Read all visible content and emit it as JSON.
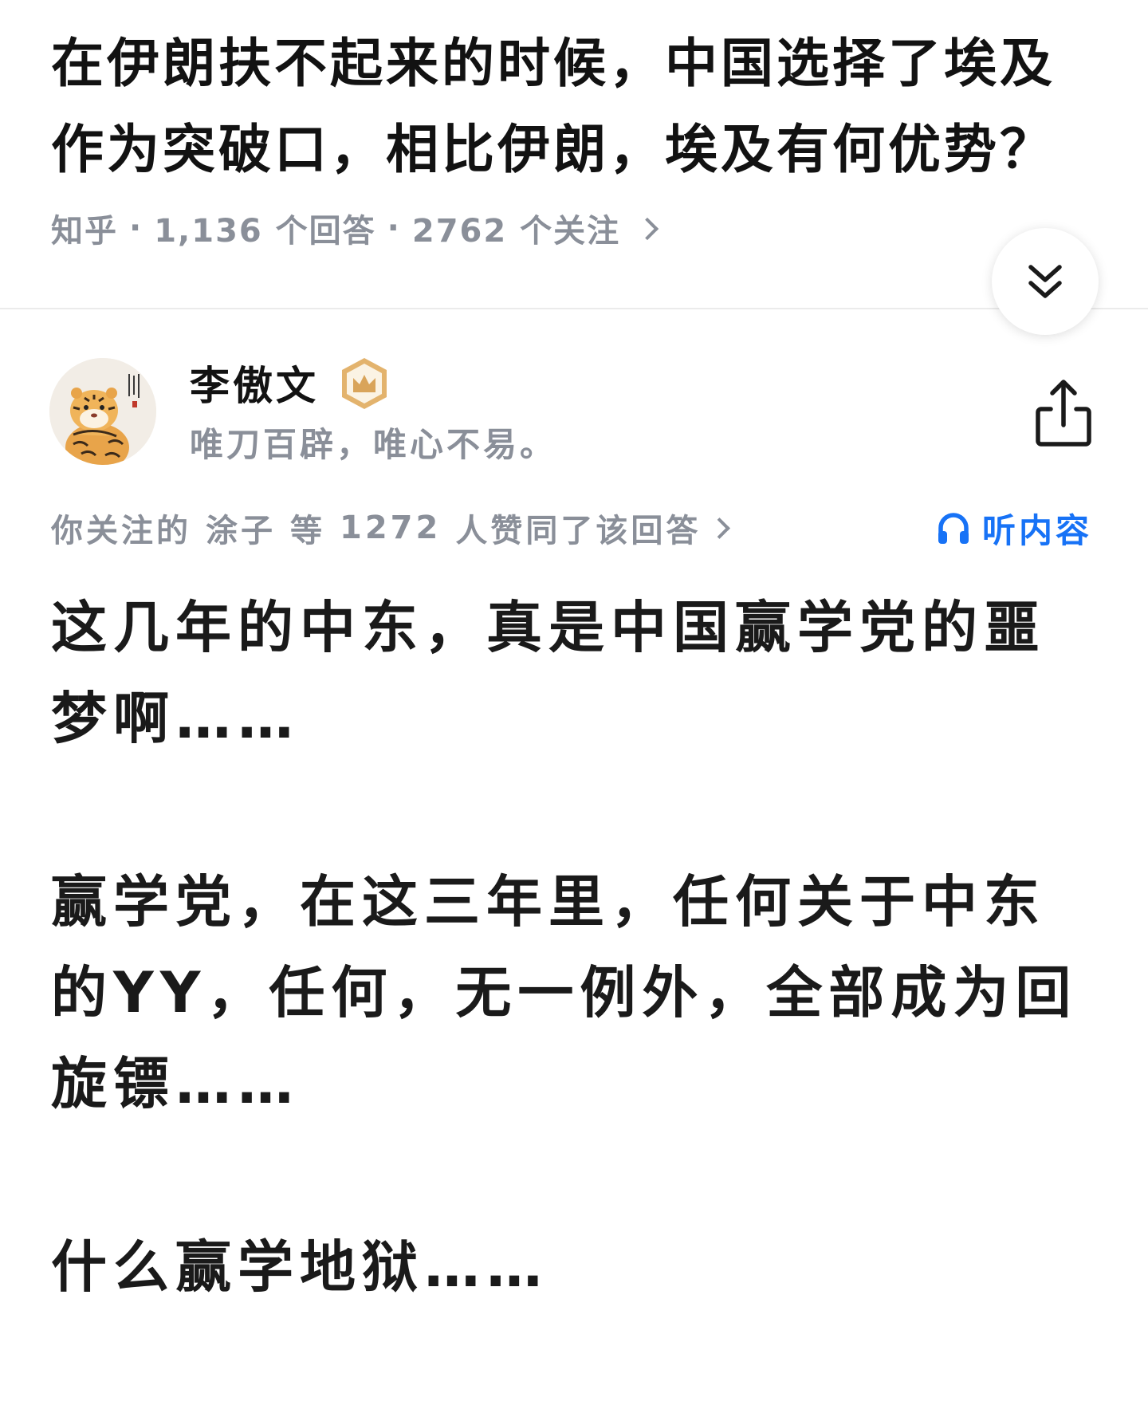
{
  "question": {
    "title": "在伊朗扶不起来的时候，中国选择了埃及作为突破口，相比伊朗，埃及有何优势？",
    "source": "知乎",
    "answers_count": "1,136 个回答",
    "followers_count": "2762 个关注"
  },
  "collapse": {
    "icon": "double-chevron-down-icon"
  },
  "author": {
    "name": "李傲文",
    "badge_icon": "crown-badge-icon",
    "bio": "唯刀百辟，唯心不易。"
  },
  "endorse": {
    "prefix": "你关注的",
    "friend": "涂子",
    "middle": "等",
    "count": "1272",
    "suffix": "人赞同了该回答"
  },
  "listen": {
    "label": "听内容",
    "icon": "headphones-icon"
  },
  "answer": {
    "paragraphs": [
      "这几年的中东，真是中国赢学党的噩梦啊……",
      "赢学党，在这三年里，任何关于中东的YY，任何，无一例外，全部成为回旋镖……",
      "什么赢学地狱……"
    ]
  },
  "colors": {
    "title": "#121212",
    "meta_gray": "#8a8f99",
    "accent_blue": "#1772f6",
    "badge_gold": "#d9a45a",
    "divider": "#ebebeb"
  }
}
